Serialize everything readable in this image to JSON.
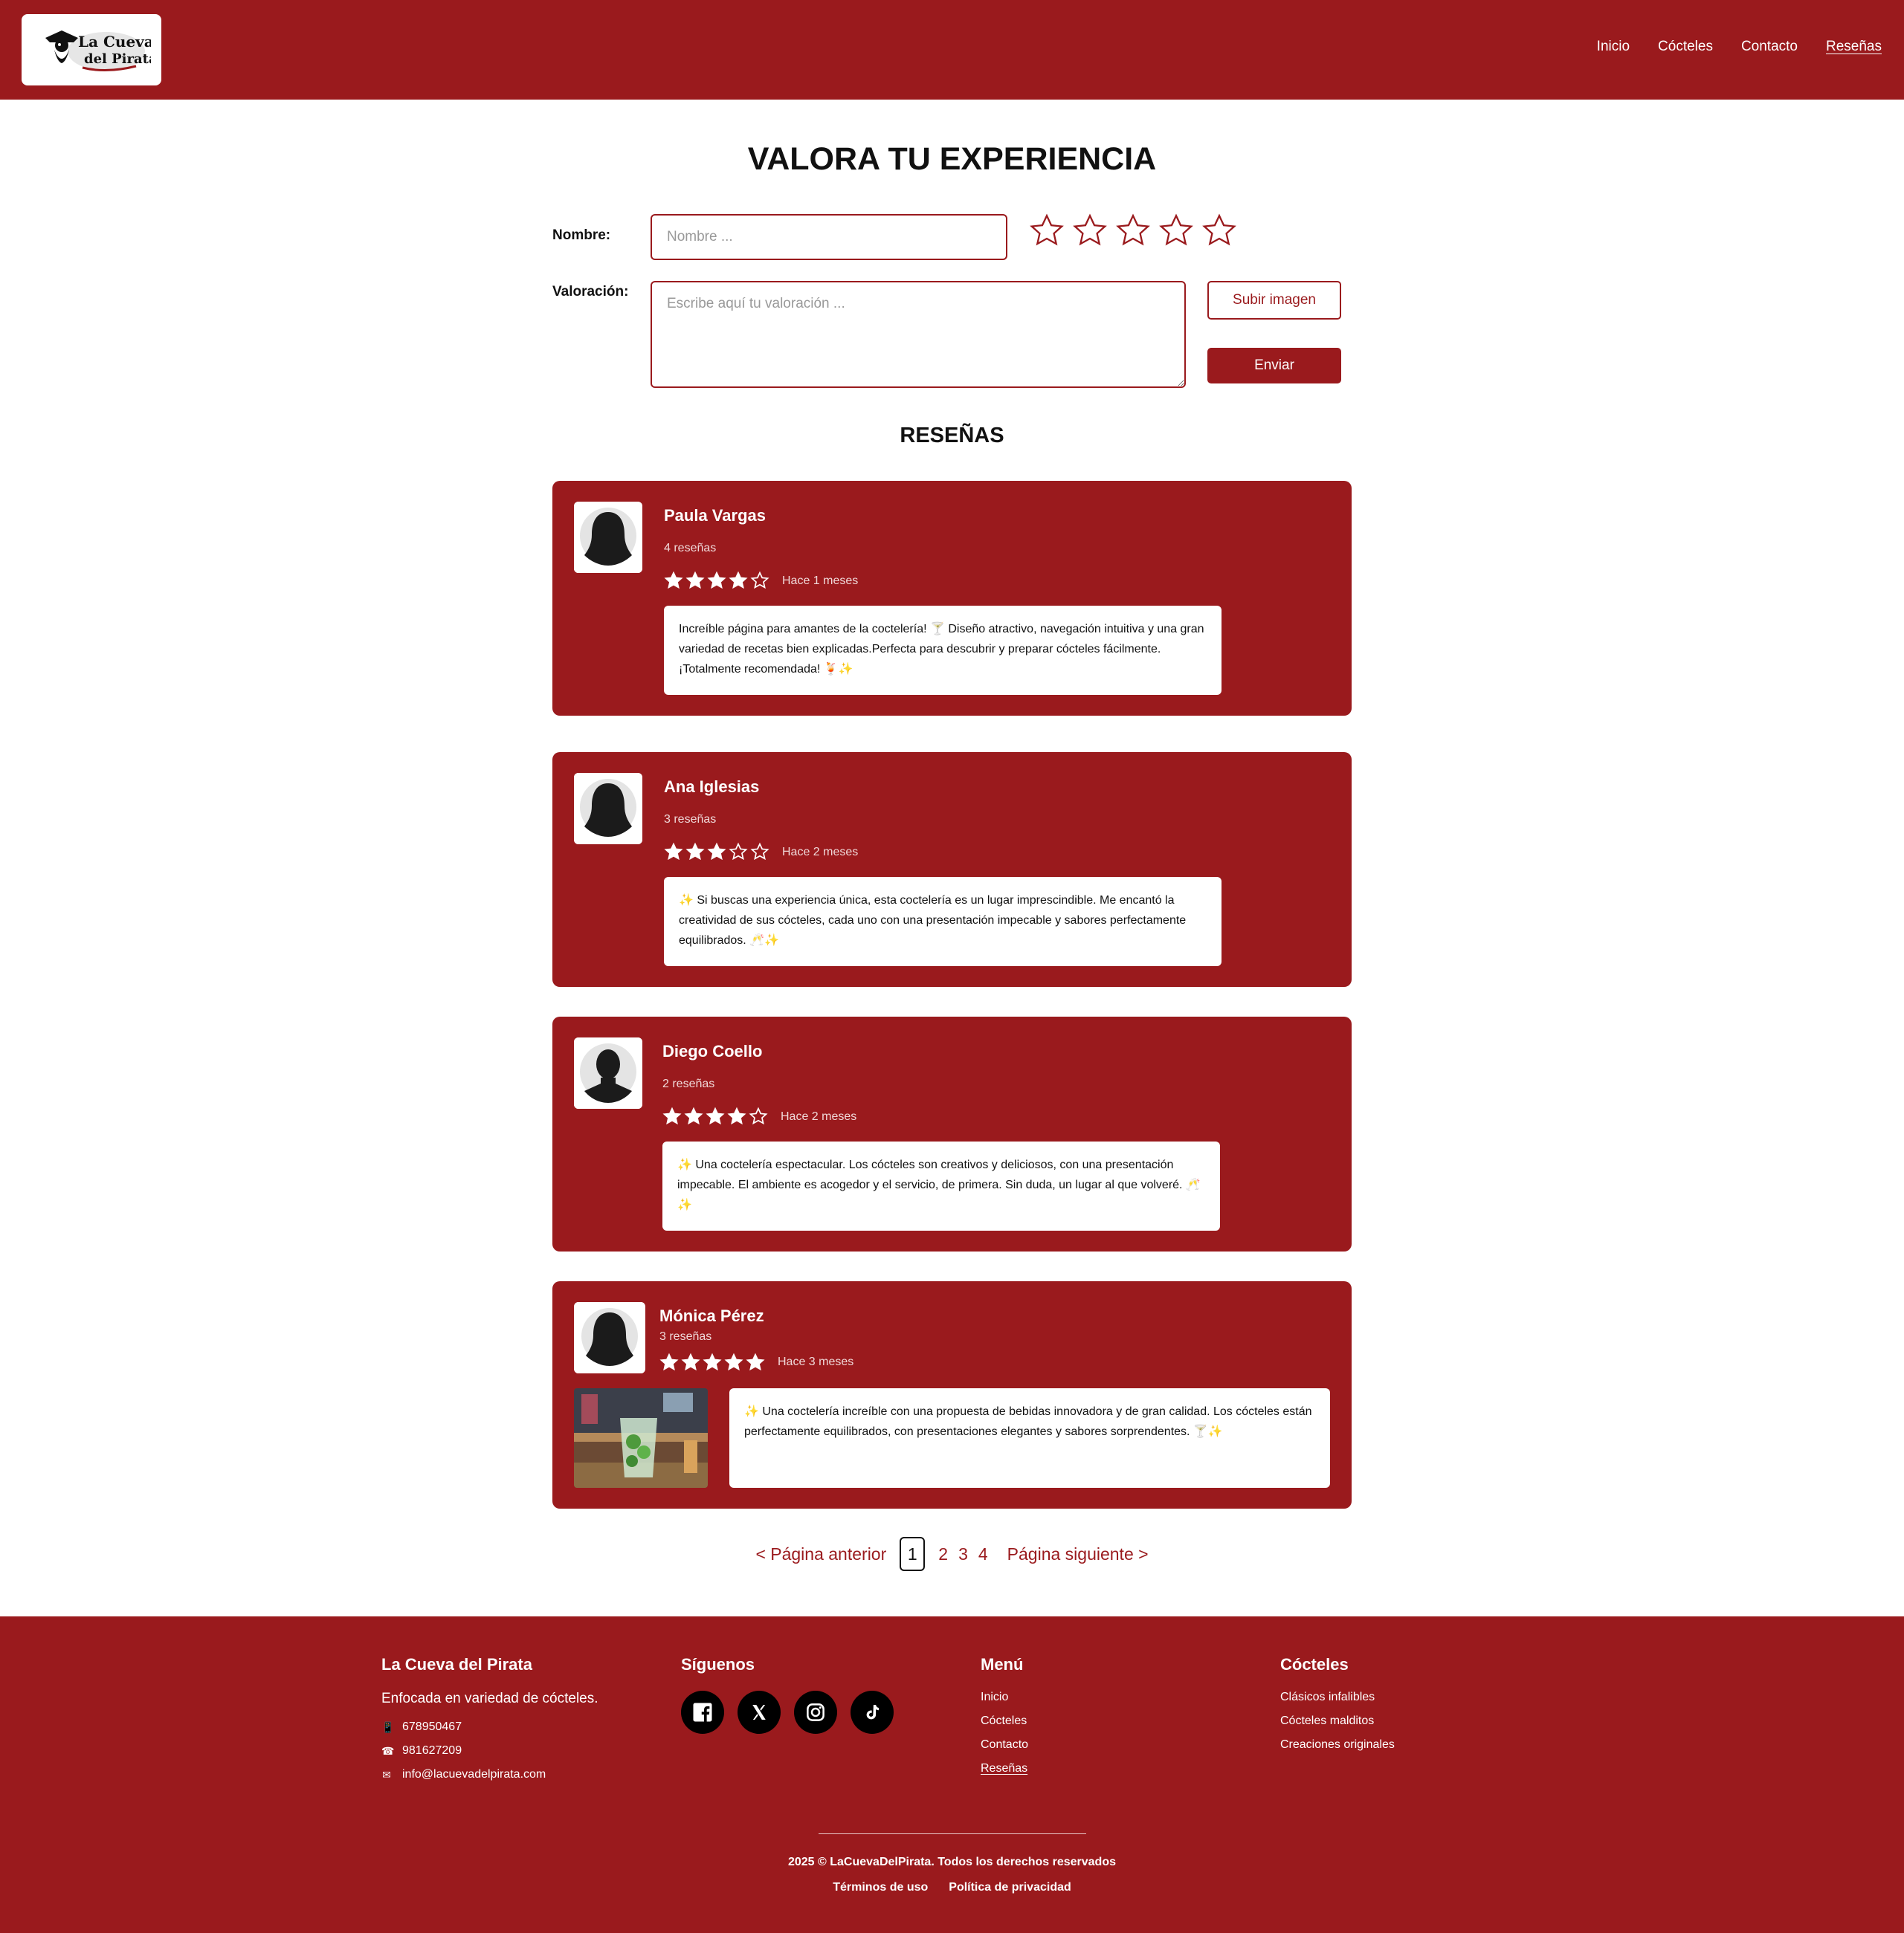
{
  "header": {
    "logo_alt": "La Cueva del Pirata",
    "nav": [
      {
        "label": "Inicio"
      },
      {
        "label": "Cócteles"
      },
      {
        "label": "Contacto"
      },
      {
        "label": "Reseñas",
        "active": true
      }
    ]
  },
  "form": {
    "title": "VALORA TU EXPERIENCIA",
    "name_label": "Nombre:",
    "name_placeholder": "Nombre ...",
    "name_value": "",
    "rating_label": "Valoración:",
    "review_placeholder": "Escribe aquí tu valoración ...",
    "review_value": "",
    "rating_selected": 0,
    "rating_max": 5,
    "upload_label": "Subir imagen",
    "send_label": "Enviar"
  },
  "reviews": {
    "title": "RESEÑAS",
    "items": [
      {
        "name": "Paula Vargas",
        "count": "4 reseñas",
        "stars": 4,
        "time": "Hace 1 meses",
        "text": "Increíble página para amantes de la coctelería! 🍸 Diseño atractivo, navegación intuitiva y una gran variedad de recetas bien explicadas.Perfecta para descubrir y preparar cócteles fácilmente. ¡Totalmente recomendada! 🍹✨",
        "avatar": "female-silhouette-icon"
      },
      {
        "name": "Ana Iglesias",
        "count": "3 reseñas",
        "stars": 3,
        "time": "Hace 2 meses",
        "text": "✨ Si buscas una experiencia única, esta coctelería es un lugar imprescindible. Me encantó la creatividad de sus cócteles, cada uno con una presentación impecable y sabores perfectamente equilibrados. 🥂✨",
        "avatar": "female-silhouette-icon"
      },
      {
        "name": "Diego Coello",
        "count": "2 reseñas",
        "stars": 4,
        "time": "Hace 2 meses",
        "text": "✨ Una coctelería espectacular. Los cócteles son creativos y deliciosos, con una presentación impecable. El ambiente es acogedor y el servicio, de primera. Sin duda, un lugar al que volveré. 🥂✨",
        "avatar": "male-silhouette-icon"
      },
      {
        "name": "Mónica Pérez",
        "count": "3 reseñas",
        "stars": 5,
        "time": "Hace 3 meses",
        "text": "✨ Una coctelería increíble con una propuesta de bebidas innovadora y de gran calidad. Los cócteles están perfectamente equilibrados, con presentaciones elegantes y sabores sorprendentes. 🍸✨",
        "avatar": "female-silhouette-icon",
        "photo": "mojito-photo"
      }
    ]
  },
  "pagination": {
    "prev": "< Página anterior",
    "pages": [
      "1",
      "2",
      "3",
      "4"
    ],
    "current": "1",
    "next": "Página siguiente >"
  },
  "footer": {
    "about": {
      "title": "La Cueva del Pirata",
      "description": "Enfocada en variedad de cócteles.",
      "mobile": "678950467",
      "phone": "981627209",
      "email": "info@lacuevadelpirata.com"
    },
    "social": {
      "title": "Síguenos",
      "icons": [
        "facebook-icon",
        "x-icon",
        "instagram-icon",
        "tiktok-icon"
      ]
    },
    "menu": {
      "title": "Menú",
      "links": [
        "Inicio",
        "Cócteles",
        "Contacto",
        "Reseñas"
      ]
    },
    "cocktails": {
      "title": "Cócteles",
      "links": [
        "Clásicos infalibles",
        "Cócteles malditos",
        "Creaciones originales"
      ]
    },
    "copyright": "2025 © LaCuevaDelPirata. Todos los derechos reservados",
    "legal": [
      "Términos de uso",
      "Política de privacidad"
    ]
  },
  "colors": {
    "brand": "#9a1a1d",
    "text": "#111111",
    "white": "#ffffff"
  }
}
